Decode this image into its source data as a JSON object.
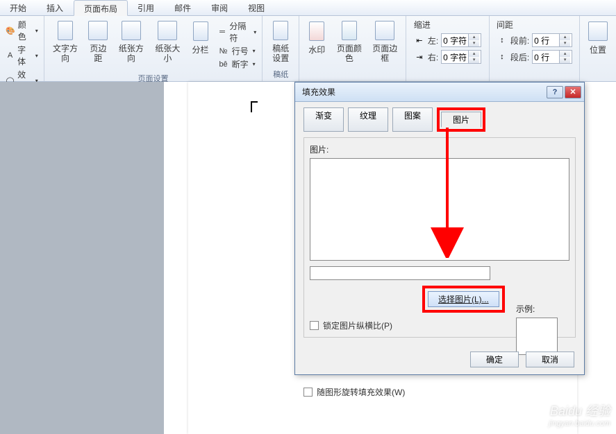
{
  "tabs": {
    "start": "开始",
    "insert": "插入",
    "layout": "页面布局",
    "reference": "引用",
    "mail": "邮件",
    "review": "审阅",
    "view": "视图"
  },
  "ribbon": {
    "theme": {
      "color": "颜色",
      "font": "字体",
      "effect": "效果"
    },
    "textDirection": "文字方向",
    "margins": "页边距",
    "orientation": "纸张方向",
    "size": "纸张大小",
    "columns": "分栏",
    "breaks": "分隔符",
    "lineNumbers": "行号",
    "hyphenation": "断字",
    "groupPageSetup": "页面设置",
    "manuscript": "稿纸\n设置",
    "groupManuscript": "稿纸",
    "watermark": "水印",
    "pageColor": "页面颜色",
    "pageBorder": "页面边框",
    "indentTitle": "缩进",
    "indentLeft": "左:",
    "indentLeftVal": "0 字符",
    "indentRight": "右:",
    "indentRightVal": "0 字符",
    "spacingTitle": "间距",
    "spacingBefore": "段前:",
    "spacingBeforeVal": "0 行",
    "spacingAfter": "段后:",
    "spacingAfterVal": "0 行",
    "position": "位置"
  },
  "dialog": {
    "title": "填充效果",
    "tabGradient": "渐变",
    "tabTexture": "纹理",
    "tabPattern": "图案",
    "tabPicture": "图片",
    "picLabel": "图片:",
    "selectPic": "选择图片(L)...",
    "lockRatio": "锁定图片纵横比(P)",
    "rotateFill": "随图形旋转填充效果(W)",
    "sample": "示例:",
    "ok": "确定",
    "cancel": "取消"
  },
  "watermark": {
    "main": "Baidu 经验",
    "sub": "jingyan.baidu.com"
  }
}
